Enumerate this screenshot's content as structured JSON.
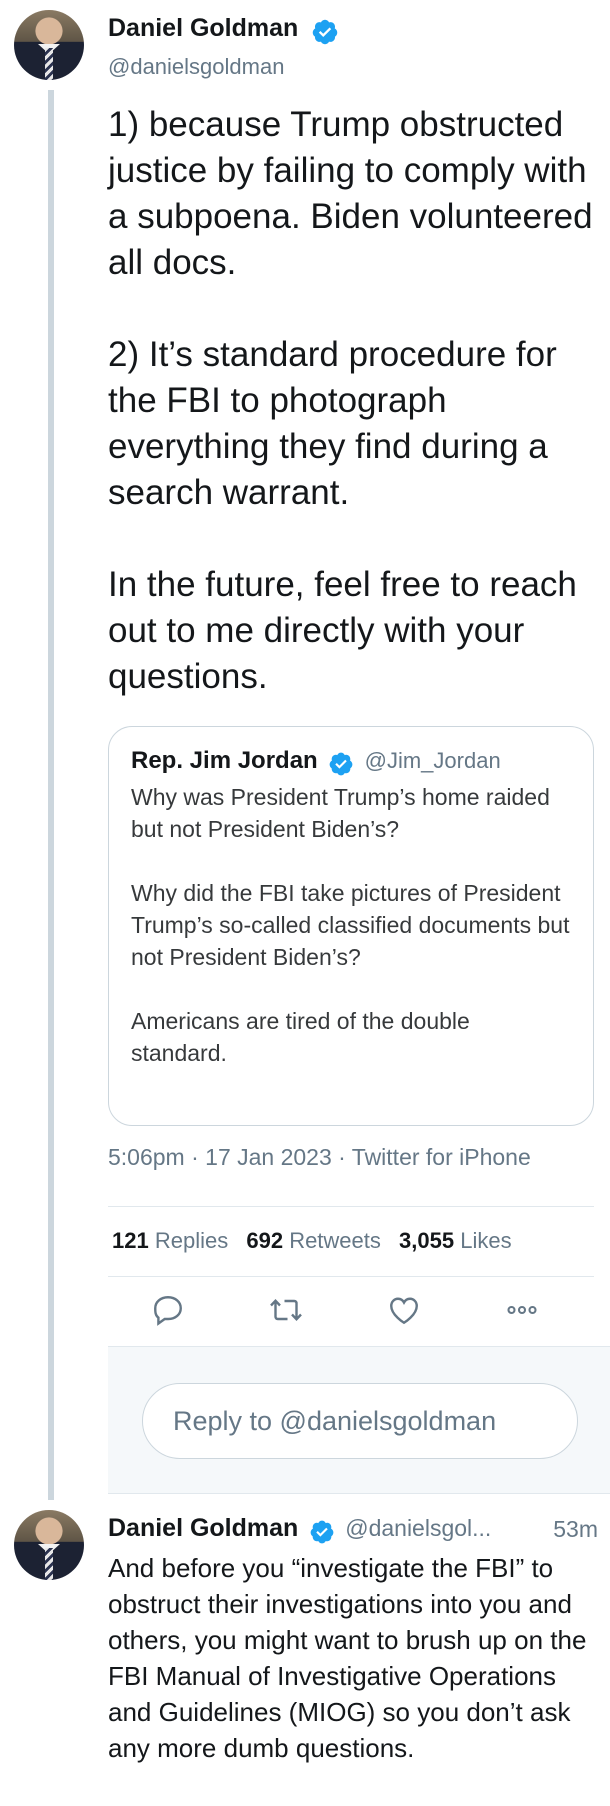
{
  "tweet": {
    "author_name": "Daniel Goldman",
    "author_handle": "@danielsgoldman",
    "text": "1) because Trump obstructed justice by failing to comply with a subpoena. Biden volunteered all docs.\n\n2) It’s standard procedure for the FBI to photograph everything they find during a search warrant.\n\nIn the future, feel free to reach out to me directly with your questions.",
    "timestamp": "5:06pm · 17 Jan 2023 · Twitter for iPhone",
    "stats": {
      "replies_count": "121",
      "replies_label": "Replies",
      "retweets_count": "692",
      "retweets_label": "Retweets",
      "likes_count": "3,055",
      "likes_label": "Likes"
    }
  },
  "quoted_tweet": {
    "author_name": "Rep. Jim Jordan",
    "author_handle": "@Jim_Jordan",
    "text": "Why was President Trump’s home raided but not President Biden’s?\n\nWhy did the FBI take pictures of President Trump’s so-called classified documents but not President Biden’s?\n\nAmericans are tired of the double standard."
  },
  "reply_box": {
    "placeholder": "Reply to @danielsgoldman"
  },
  "reply_tweet": {
    "author_name": "Daniel Goldman",
    "author_handle": "@danielsgol...",
    "time": "53m",
    "text": "And before you “investigate the FBI” to obstruct their investigations into you and others, you might want to brush up on the FBI Manual of Investigative Operations and Guidelines (MIOG) so you don’t ask any more dumb questions."
  },
  "icons": {
    "verified": "verified-badge-icon",
    "reply": "reply-icon",
    "retweet": "retweet-icon",
    "like": "heart-icon",
    "more": "more-icon"
  },
  "colors": {
    "verified_blue": "#1da1f2",
    "secondary_text": "#657786",
    "primary_text": "#14171a"
  }
}
